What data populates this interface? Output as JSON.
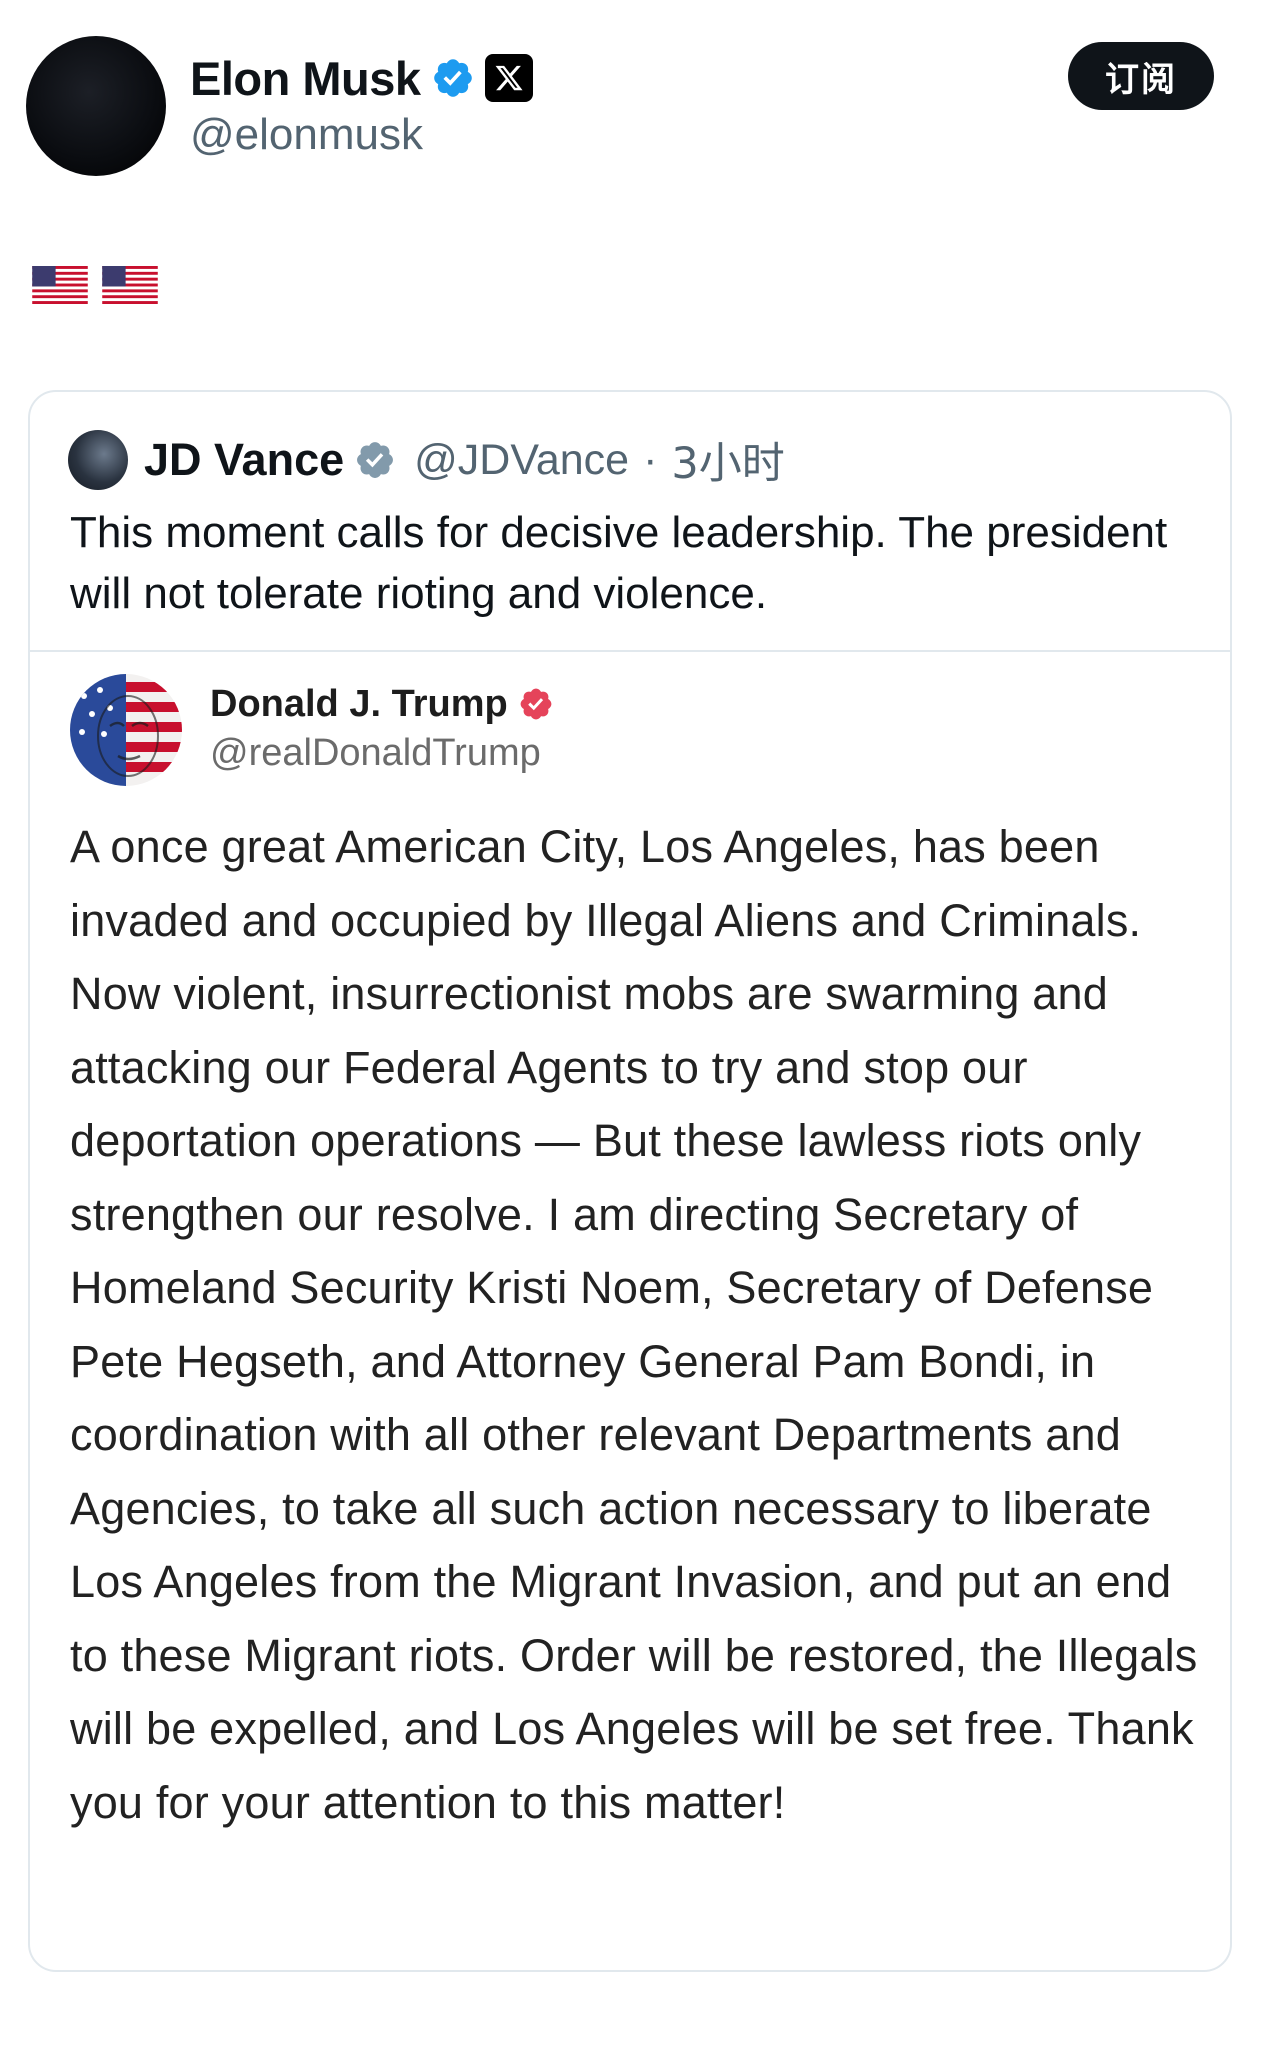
{
  "author": {
    "name": "Elon Musk",
    "handle": "@elonmusk",
    "subscribe_label": "订阅"
  },
  "post": {
    "content": "🇺🇸 🇺🇸"
  },
  "quoted_post": {
    "author": {
      "name": "JD Vance",
      "handle": "@JDVance",
      "separator": "·",
      "time": "3小时"
    },
    "text": "This moment calls for decisive leadership. The president will not tolerate rioting and violence.",
    "embedded_post": {
      "author": {
        "name": "Donald J. Trump",
        "handle": "@realDonaldTrump"
      },
      "text": "A once great American City, Los Angeles, has been invaded and occupied by Illegal Aliens and Criminals.  Now violent, insurrectionist mobs are swarming and attacking our Federal Agents to try and stop our deportation operations — But these lawless riots only strengthen our resolve. I am directing Secretary of Homeland Security Kristi Noem, Secretary of Defense Pete Hegseth, and Attorney General Pam Bondi, in coordination with all other relevant Departments and Agencies, to take all such action necessary to liberate Los Angeles from the Migrant Invasion, and put an end to these Migrant riots. Order will be restored, the Illegals will be expelled, and Los Angeles will be set free. Thank you for your attention to this matter!"
    }
  },
  "colors": {
    "verified_blue": "#1d9bf0",
    "verified_gray": "#829aab",
    "truth_verified": "#e5435a",
    "muted_text": "#536471",
    "border": "#e1e8ed"
  }
}
